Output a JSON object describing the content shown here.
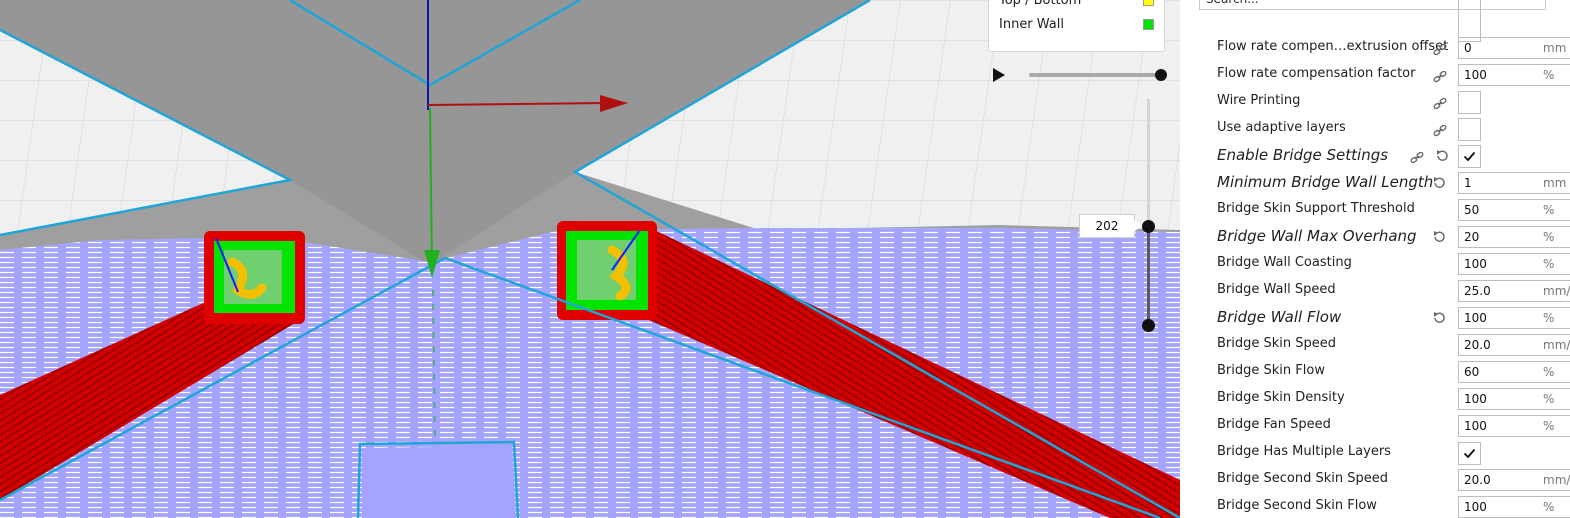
{
  "viewport": {
    "legend": {
      "items": [
        {
          "label": "Top / Bottom",
          "color": "#ffff00"
        },
        {
          "label": "Inner Wall",
          "color": "#00e400"
        }
      ]
    },
    "simulation": {
      "play_icon": "play-icon"
    },
    "layer_view": {
      "current_layer": "202"
    },
    "colors": {
      "outer_wall": "#e00000",
      "inner_wall": "#00e400",
      "skin": "#a4a4ff",
      "build_plate": "#f0f0f0",
      "shadow": "#9a9a9a",
      "outline": "#1fa5d8"
    }
  },
  "settings": {
    "search": {
      "placeholder": "Search..."
    },
    "rows": [
      {
        "label": "Flow rate compen…extrusion offset",
        "value": "0",
        "unit": "mm",
        "linked": true
      },
      {
        "label": "Flow rate compensation factor",
        "value": "100",
        "unit": "%",
        "linked": true
      },
      {
        "label": "Wire Printing",
        "type": "checkbox",
        "checked": false,
        "linked": true
      },
      {
        "label": "Use adaptive layers",
        "type": "checkbox",
        "checked": false,
        "linked": true
      },
      {
        "label": "Enable Bridge Settings",
        "type": "checkbox",
        "checked": true,
        "overridden": true,
        "linked": true
      },
      {
        "label": "Minimum Bridge Wall Length",
        "value": "1",
        "unit": "mm",
        "overridden": true
      },
      {
        "label": "Bridge Skin Support Threshold",
        "value": "50",
        "unit": "%"
      },
      {
        "label": "Bridge Wall Max Overhang",
        "value": "20",
        "unit": "%",
        "overridden": true
      },
      {
        "label": "Bridge Wall Coasting",
        "value": "100",
        "unit": "%"
      },
      {
        "label": "Bridge Wall Speed",
        "value": "25.0",
        "unit": "mm/s"
      },
      {
        "label": "Bridge Wall Flow",
        "value": "100",
        "unit": "%",
        "overridden": true
      },
      {
        "label": "Bridge Skin Speed",
        "value": "20.0",
        "unit": "mm/s"
      },
      {
        "label": "Bridge Skin Flow",
        "value": "60",
        "unit": "%"
      },
      {
        "label": "Bridge Skin Density",
        "value": "100",
        "unit": "%"
      },
      {
        "label": "Bridge Fan Speed",
        "value": "100",
        "unit": "%"
      },
      {
        "label": "Bridge Has Multiple Layers",
        "type": "checkbox",
        "checked": true
      },
      {
        "label": "Bridge Second Skin Speed",
        "value": "20.0",
        "unit": "mm/s"
      },
      {
        "label": "Bridge Second Skin Flow",
        "value": "100",
        "unit": "%"
      }
    ]
  }
}
